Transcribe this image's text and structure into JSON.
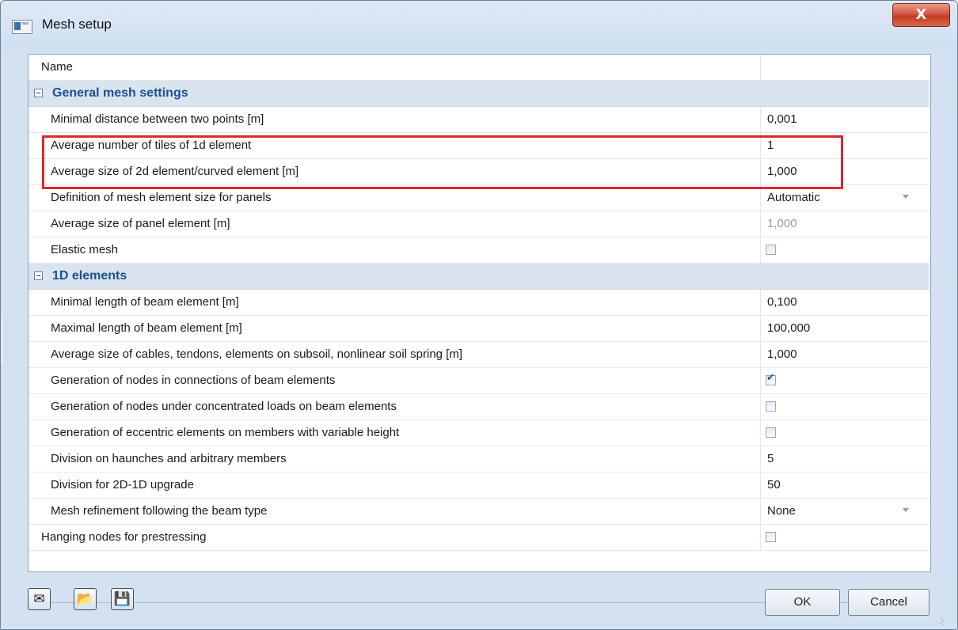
{
  "window": {
    "title": "Mesh setup",
    "close_label": "X"
  },
  "grid": {
    "header": {
      "name": "Name",
      "value": ""
    },
    "groups": [
      {
        "label": "General mesh settings",
        "rows": [
          {
            "name": "Minimal distance between two points [m]",
            "value": "0,001",
            "kind": "text"
          },
          {
            "name": "Average number of tiles of 1d element",
            "value": "1",
            "kind": "text"
          },
          {
            "name": "Average size of 2d element/curved element [m]",
            "value": "1,000",
            "kind": "text"
          },
          {
            "name": "Definition of mesh element size for panels",
            "value": "Automatic",
            "kind": "dropdown"
          },
          {
            "name": "Average size of panel element [m]",
            "value": "1,000",
            "kind": "disabled"
          },
          {
            "name": "Elastic mesh",
            "value": "",
            "kind": "checkbox",
            "checked": false
          }
        ]
      },
      {
        "label": "1D elements",
        "rows": [
          {
            "name": "Minimal length of beam element [m]",
            "value": "0,100",
            "kind": "text"
          },
          {
            "name": "Maximal length of beam element [m]",
            "value": "100,000",
            "kind": "text"
          },
          {
            "name": "Average size of cables, tendons, elements on subsoil, nonlinear soil spring [m]",
            "value": "1,000",
            "kind": "text"
          },
          {
            "name": "Generation of nodes in connections of beam elements",
            "value": "",
            "kind": "checkbox",
            "checked": true
          },
          {
            "name": "Generation of nodes under concentrated loads on beam elements",
            "value": "",
            "kind": "checkbox",
            "checked": false
          },
          {
            "name": "Generation of eccentric elements on members with variable height",
            "value": "",
            "kind": "checkbox",
            "checked": false
          },
          {
            "name": "Division on haunches and arbitrary members",
            "value": "5",
            "kind": "text"
          },
          {
            "name": "Division for 2D-1D upgrade",
            "value": "50",
            "kind": "text"
          },
          {
            "name": "Mesh refinement following the beam type",
            "value": "None",
            "kind": "dropdown"
          }
        ]
      }
    ],
    "toplevel": {
      "name": "Hanging nodes for prestressing",
      "value": "",
      "kind": "checkbox",
      "checked": false
    }
  },
  "footer": {
    "tools": [
      {
        "icon": "export-icon",
        "glyph": "✉"
      },
      {
        "icon": "open-folder-icon",
        "glyph": "📂"
      },
      {
        "icon": "save-icon",
        "glyph": "💾"
      }
    ],
    "ok_label": "OK",
    "cancel_label": "Cancel"
  },
  "colors": {
    "highlight": "#e0262e",
    "group_text": "#1d4f91",
    "group_bg": "#d9e4ef"
  }
}
